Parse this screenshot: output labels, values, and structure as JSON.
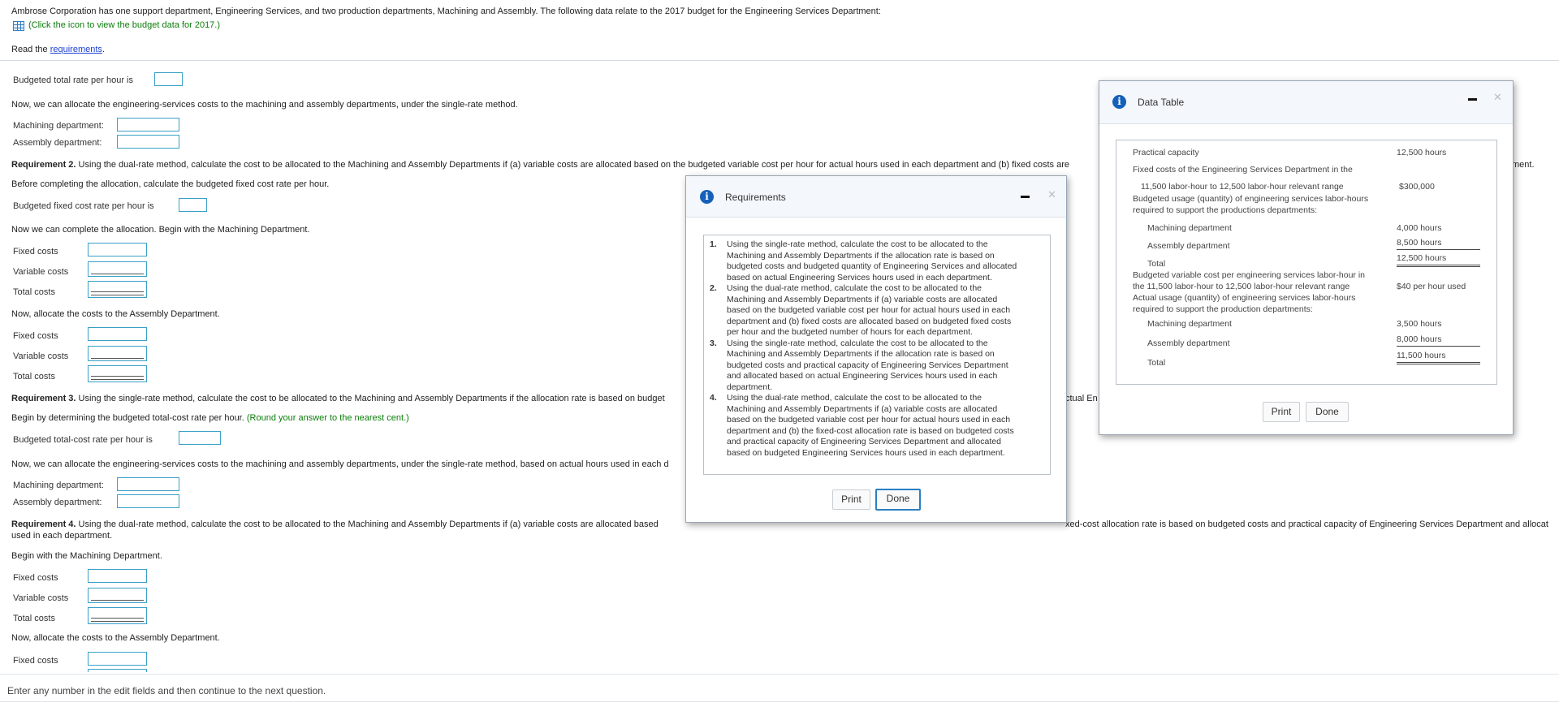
{
  "intro": {
    "text": "Ambrose Corporation has one support department, Engineering Services, and two production departments, Machining and Assembly. The following data relate to the 2017 budget for the Engineering Services Department:",
    "click_icon_text": "(Click the icon to view the budget data for 2017.)",
    "read_the": "Read the",
    "requirements_link": "requirements",
    "period": "."
  },
  "section1": {
    "budgeted_total_rate": "Budgeted total rate per hour is",
    "allocate_text": "Now, we can allocate the engineering-services costs to the machining and assembly departments, under the single-rate method.",
    "machining": "Machining department:",
    "assembly": "Assembly department:"
  },
  "req2": {
    "label": "Requirement 2.",
    "text": " Using the dual-rate method, calculate the cost to be allocated to the Machining and Assembly Departments if (a) variable costs are allocated based on the budgeted variable cost per hour for actual hours used in each department and (b) fixed costs are",
    "tail": "ment.",
    "before": "Before completing the allocation, calculate the budgeted fixed cost rate per hour.",
    "fixed_rate": "Budgeted fixed cost rate per hour is",
    "complete_machining": "Now we can complete the allocation. Begin with the Machining Department.",
    "allocate_assembly": "Now, allocate the costs to the Assembly Department."
  },
  "rows": {
    "fixed": "Fixed costs",
    "variable": "Variable costs",
    "total": "Total costs"
  },
  "req3": {
    "label": "Requirement 3.",
    "text": " Using the single-rate method, calculate the cost to be allocated to the Machining and Assembly Departments if the allocation rate is based on budget",
    "tail": "ctual En",
    "begin": "Begin by determining the budgeted total-cost rate per hour.",
    "round": "(Round your answer to the nearest cent.)",
    "total_rate": "Budgeted total-cost rate per hour is",
    "allocate_text": "Now, we can allocate the engineering-services costs to the machining and assembly departments, under the single-rate method, based on actual hours used in each d",
    "machining": "Machining department:",
    "assembly": "Assembly department:"
  },
  "req4": {
    "label": "Requirement 4.",
    "text": " Using the dual-rate method, calculate the cost to be allocated to the Machining and Assembly Departments if (a) variable costs are allocated based",
    "tail": "xed-cost allocation rate is based on budgeted costs and practical capacity of Engineering Services Department and allocat",
    "line2": "used in each department.",
    "begin_machining": "Begin with the Machining Department.",
    "allocate_assembly": "Now, allocate the costs to the Assembly Department."
  },
  "footer": "Enter any number in the edit fields and then continue to the next question.",
  "requirements_dialog": {
    "title": "Requirements",
    "items": [
      {
        "num": "1.",
        "lines": [
          "Using the single-rate method, calculate the cost to be allocated to the",
          "Machining and Assembly Departments if the allocation rate is based on",
          "budgeted costs and budgeted quantity of Engineering Services and allocated",
          "based on actual Engineering Services hours used in each department."
        ]
      },
      {
        "num": "2.",
        "lines": [
          "Using the dual-rate method, calculate the cost to be allocated to the",
          "Machining and Assembly Departments if (a) variable costs are allocated",
          "based on the budgeted variable cost per hour for actual hours used in each",
          "department and (b) fixed costs are allocated based on budgeted fixed costs",
          "per hour and the budgeted number of hours for each department."
        ]
      },
      {
        "num": "3.",
        "lines": [
          "Using the single-rate method, calculate the cost to be allocated to the",
          "Machining and Assembly Departments if the allocation rate is based on",
          "budgeted costs and practical capacity of Engineering Services Department",
          "and allocated based on actual Engineering Services hours used in each",
          "department."
        ]
      },
      {
        "num": "4.",
        "lines": [
          "Using the dual-rate method, calculate the cost to be allocated to the",
          "Machining and Assembly Departments if (a) variable costs are allocated",
          "based on the budgeted variable cost per hour for actual hours used in each",
          "department and (b) the fixed-cost allocation rate is based on budgeted costs",
          "and practical capacity of Engineering Services Department and allocated",
          "based on budgeted Engineering Services hours used in each department."
        ]
      }
    ],
    "print": "Print",
    "done": "Done"
  },
  "data_dialog": {
    "title": "Data Table",
    "practical_capacity": "Practical capacity",
    "practical_capacity_val": "12,500 hours",
    "fixed_costs_1": "Fixed costs of the Engineering Services Department in the",
    "fixed_costs_2": "11,500 labor-hour to 12,500 labor-hour relevant range",
    "fixed_costs_val": "$300,000",
    "budgeted_usage_1": "Budgeted usage (quantity) of engineering services labor-hours",
    "budgeted_usage_2": "required to support the productions departments:",
    "machining_dept": "Machining department",
    "machining_budget": "4,000 hours",
    "assembly_dept": "Assembly department",
    "assembly_budget": "8,500 hours",
    "total": "Total",
    "total_budget": "12,500 hours",
    "var_cost_1": "Budgeted variable cost per engineering services labor-hour in",
    "var_cost_2": "the 11,500 labor-hour to 12,500 labor-hour relevant range",
    "var_cost_val": "$40 per hour used",
    "actual_usage_1": "Actual usage (quantity) of engineering services labor-hours",
    "actual_usage_2": "required to support the production departments:",
    "machining_actual": "3,500 hours",
    "assembly_actual": "8,000 hours",
    "total_actual": "11,500 hours",
    "print": "Print",
    "done": "Done"
  }
}
